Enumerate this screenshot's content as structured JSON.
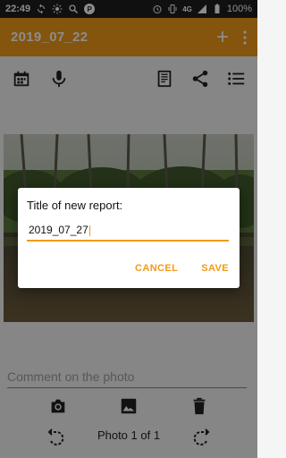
{
  "status_bar": {
    "time": "22:49",
    "network": "4G",
    "battery": "100%",
    "left_icons": [
      "sync-icon",
      "brightness-icon",
      "search-icon",
      "p-badge-icon"
    ],
    "right_icons": [
      "alarm-icon",
      "vibrate-icon",
      "signal-icon",
      "battery-icon"
    ]
  },
  "app_bar": {
    "title": "2019_07_22",
    "actions": [
      "add-icon",
      "overflow-menu-icon"
    ],
    "color": "#f29a18"
  },
  "toolbar": {
    "left": [
      "calendar-icon",
      "microphone-icon"
    ],
    "right": [
      "document-icon",
      "share-icon",
      "list-icon"
    ]
  },
  "main": {
    "comment_placeholder": "Comment on the photo",
    "photo_actions": [
      "camera-icon",
      "image-icon",
      "delete-icon"
    ],
    "photo_counter": "Photo 1 of 1",
    "rotate_icons": [
      "rotate-left-icon",
      "rotate-right-icon"
    ]
  },
  "dialog": {
    "title": "Title of new report:",
    "input_value": "2019_07_27",
    "cancel_label": "CANCEL",
    "save_label": "SAVE",
    "accent": "#f29a18"
  }
}
